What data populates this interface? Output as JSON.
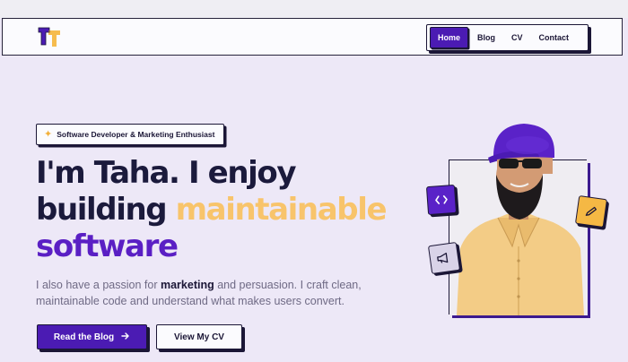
{
  "nav": {
    "items": [
      {
        "label": "Home",
        "active": true
      },
      {
        "label": "Blog",
        "active": false
      },
      {
        "label": "CV",
        "active": false
      },
      {
        "label": "Contact",
        "active": false
      }
    ]
  },
  "hero": {
    "badge": "Software Developer & Marketing Enthusiast",
    "headline": {
      "line1": "I'm Taha. I enjoy",
      "line2_start": "building ",
      "line2_highlight": "maintainable",
      "line3": "software"
    },
    "paragraph": {
      "before": "I also have a passion for ",
      "bold": "marketing",
      "after": " and persuasion. I craft clean, maintainable code and understand what makes users convert."
    },
    "primary_button": "Read the Blog",
    "secondary_button": "View My CV"
  },
  "icons": {
    "badge": "sparkle-icon",
    "primary_button": "arrow-right-icon",
    "floating": [
      "code-icon",
      "pencil-icon",
      "megaphone-icon"
    ]
  },
  "colors": {
    "brand_purple": "#4b1bb3",
    "highlight_yellow": "#f8c46b",
    "ink": "#1b1a3c",
    "background": "#ede8f7"
  }
}
